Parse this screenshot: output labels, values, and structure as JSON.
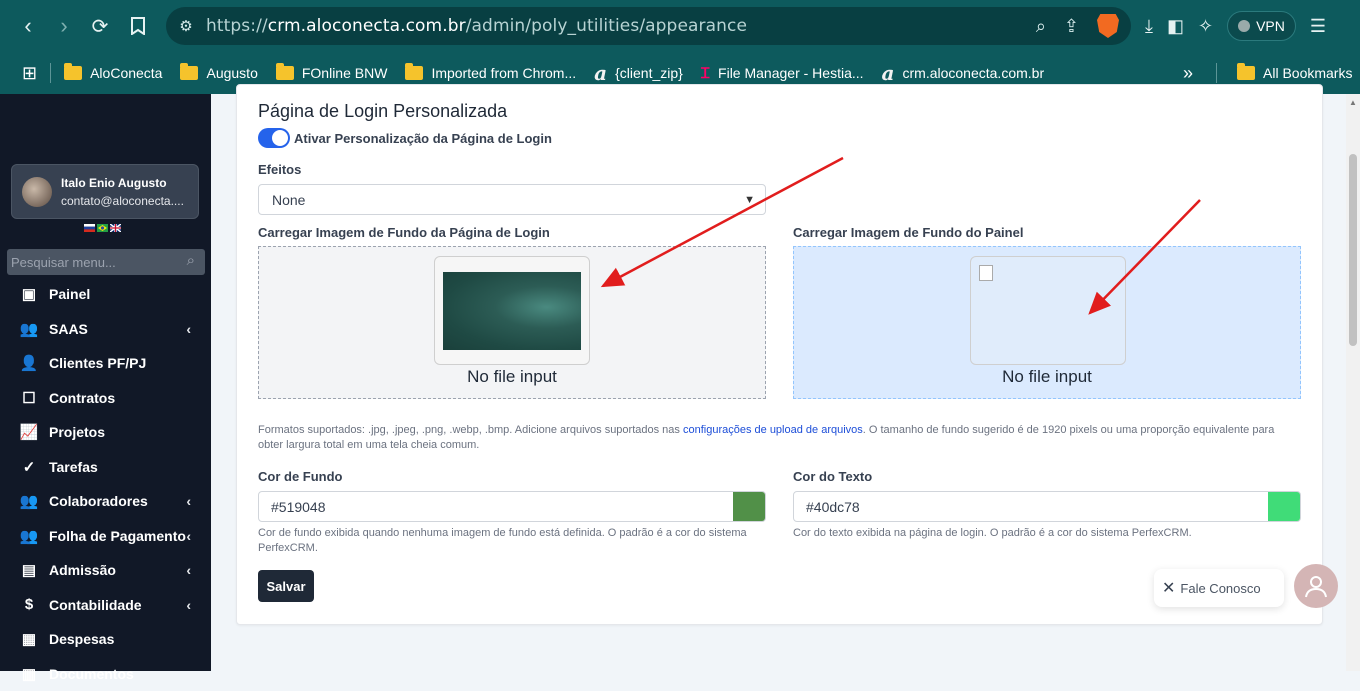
{
  "browser": {
    "url_prefix": "https://",
    "url_host": "crm.aloconecta.com.br",
    "url_path": "/admin/poly_utilities/appearance",
    "vpn_label": "VPN"
  },
  "bookmarks": [
    {
      "label": "AloConecta",
      "icon": "folder-icon"
    },
    {
      "label": "Augusto",
      "icon": "folder-icon"
    },
    {
      "label": "FOnline BNW",
      "icon": "folder-icon"
    },
    {
      "label": "Imported from Chrom...",
      "icon": "folder-icon"
    },
    {
      "label": "{client_zip}",
      "icon": "aloconecta-logo-icon"
    },
    {
      "label": "File Manager - Hestia...",
      "icon": "hestia-icon"
    },
    {
      "label": "crm.aloconecta.com.br",
      "icon": "aloconecta-logo-icon"
    }
  ],
  "all_bookmarks": "All Bookmarks",
  "sidebar": {
    "user_name": "Italo Enio Augusto",
    "user_email": "contato@aloconecta....",
    "search_placeholder": "Pesquisar menu...",
    "items": [
      {
        "label": "Painel",
        "icon": "dashboard-icon",
        "chevron": false
      },
      {
        "label": "SAAS",
        "icon": "users-icon",
        "chevron": true
      },
      {
        "label": "Clientes PF/PJ",
        "icon": "user-icon",
        "chevron": false
      },
      {
        "label": "Contratos",
        "icon": "contract-icon",
        "chevron": false
      },
      {
        "label": "Projetos",
        "icon": "chart-icon",
        "chevron": false
      },
      {
        "label": "Tarefas",
        "icon": "check-circle-icon",
        "chevron": false
      },
      {
        "label": "Colaboradores",
        "icon": "users-icon",
        "chevron": true
      },
      {
        "label": "Folha de Pagamento",
        "icon": "users-icon",
        "chevron": true
      },
      {
        "label": "Admissão",
        "icon": "id-card-icon",
        "chevron": true
      },
      {
        "label": "Contabilidade",
        "icon": "dollar-icon",
        "chevron": true
      },
      {
        "label": "Despesas",
        "icon": "receipt-icon",
        "chevron": false
      },
      {
        "label": "Documentos",
        "icon": "document-icon",
        "chevron": false
      }
    ]
  },
  "form": {
    "title": "Página de Login Personalizada",
    "toggle_label": "Ativar Personalização da Página de Login",
    "effects_label": "Efeitos",
    "effects_value": "None",
    "login_bg_label": "Carregar Imagem de Fundo da Página de Login",
    "panel_bg_label": "Carregar Imagem de Fundo do Painel",
    "no_file_login": "No file input",
    "no_file_panel": "No file input",
    "formats_help_1": "Formatos suportados: .jpg, .jpeg, .png, .webp, .bmp. Adicione arquivos suportados nas",
    "formats_help_link": "configurações de upload de arquivos",
    "formats_help_2": ". O tamanho de fundo sugerido é de 1920 pixels ou uma proporção equivalente para obter largura total em uma tela cheia comum.",
    "bg_color_label": "Cor de Fundo",
    "bg_color_value": "#519048",
    "bg_color_help": "Cor de fundo exibida quando nenhuma imagem de fundo está definida. O padrão é a cor do sistema PerfexCRM.",
    "text_color_label": "Cor do Texto",
    "text_color_value": "#40dc78",
    "text_color_help": "Cor do texto exibida na página de login. O padrão é a cor do sistema PerfexCRM.",
    "save_label": "Salvar"
  },
  "chat": {
    "label": "Fale Conosco"
  },
  "colors": {
    "browser_bar": "#0d5a5d",
    "sidebar": "#111827",
    "bg_swatch": "#519048",
    "text_swatch": "#40dc78",
    "arrow": "#e11d1d"
  }
}
